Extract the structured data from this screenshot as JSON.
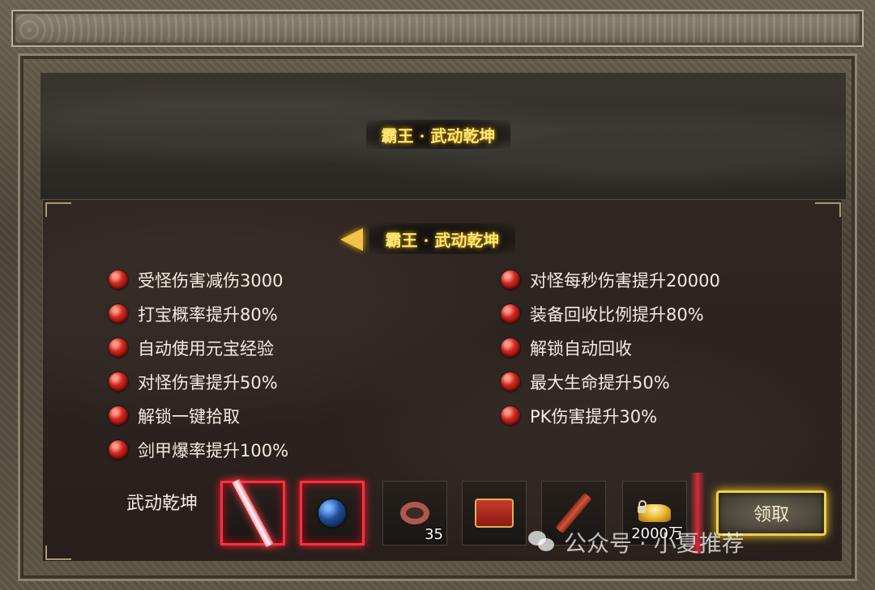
{
  "header": {
    "title": "霸王 · 武动乾坤"
  },
  "panel": {
    "subtitle": "霸王 · 武动乾坤"
  },
  "perks_left": [
    "受怪伤害减伤3000",
    "打宝概率提升80%",
    "自动使用元宝经验",
    "对怪伤害提升50%",
    "解锁一键拾取",
    "剑甲爆率提升100%"
  ],
  "perks_right": [
    "对怪每秒伤害提升20000",
    "装备回收比例提升80%",
    "解锁自动回收",
    "最大生命提升50%",
    "PK伤害提升30%"
  ],
  "rewards": {
    "label": "武动乾坤",
    "items": [
      {
        "icon": "sword-icon",
        "qty": ""
      },
      {
        "icon": "blue-orb-icon",
        "qty": ""
      },
      {
        "icon": "ring-icon",
        "qty": "35"
      },
      {
        "icon": "treasure-chest-icon",
        "qty": ""
      },
      {
        "icon": "scroll-icon",
        "qty": ""
      },
      {
        "icon": "gold-ingot-icon",
        "qty": "2000万"
      }
    ]
  },
  "claim_button": {
    "label": "领取"
  },
  "watermark": {
    "text": "公众号 · 小夏推荐"
  }
}
